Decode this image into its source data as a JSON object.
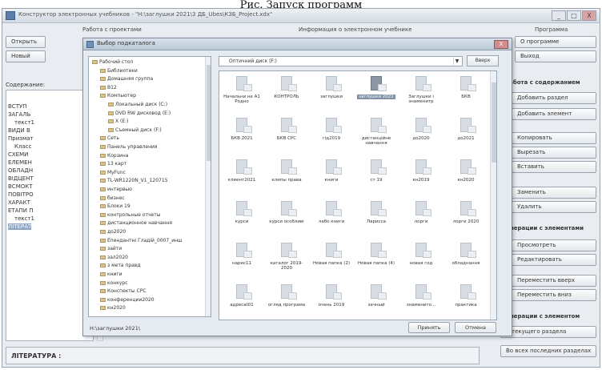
{
  "caption": "Рис. Запуск программ",
  "window": {
    "title": "Конструктор электронных учебников - \"Н:\\заглушки 2021\\3 ДБ_Ubes\\КЗБ_Project.xdx\"",
    "buttons": [
      "_",
      "□",
      "X"
    ]
  },
  "groups": {
    "projects": "Работа с проектами",
    "info": "Информация о электронном учебнике",
    "program": "Программа"
  },
  "toolbar": {
    "open": "Открыть",
    "new": "Новый",
    "about": "О программе",
    "exit": "Выход"
  },
  "content_label": "Содержание:",
  "tree": [
    {
      "label": "ВСТУП"
    },
    {
      "label": "ЗАГАЛЬ"
    },
    {
      "label": "текст1"
    },
    {
      "label": "ВИДИ  В"
    },
    {
      "label": "Призмат"
    },
    {
      "label": "Класс"
    },
    {
      "label": "СХЕМИ"
    },
    {
      "label": "ЕЛЕМЕН"
    },
    {
      "label": "ОБЛАДН"
    },
    {
      "label": "ВІДЦЕНТ"
    },
    {
      "label": "ВСМОКТ"
    },
    {
      "label": "ПОВІТРО"
    },
    {
      "label": "ХАРАКТ"
    },
    {
      "label": "ЕТАПИ П"
    },
    {
      "label": "текст1"
    },
    {
      "label": "ЛІТЕРАТ"
    }
  ],
  "right_panel": {
    "sec_content": "Работа с содержанием",
    "add_section": "Добавить раздел",
    "add_subsection": "Добавить элемент",
    "copy": "Копировать",
    "cut": "Вырезать",
    "paste": "Вставить",
    "rename": "Заменить",
    "delete": "Удалить",
    "sec_elements": "Операции с элементами",
    "view": "Просмотреть",
    "edit": "Редактировать",
    "move_up": "Переместить вверх",
    "move_down": "Переместить вниз",
    "sec_links": "Операции с элементом",
    "to_section": "В текущего раздела",
    "to_all": "Во всех последних разделах"
  },
  "literature": "ЛІТЕРАТУРА :",
  "dialog": {
    "title": "Выбор подкаталога",
    "close": "X",
    "drive": "Оптичний диск (F:)",
    "up": "Вверх",
    "path": "H:\\заглушки 2021\\",
    "ok": "Принять",
    "cancel": "Отмена",
    "folders": [
      {
        "label": "Рабочий стол",
        "indent": 0
      },
      {
        "label": "Библиотеки",
        "indent": 1
      },
      {
        "label": "Домашняя группа",
        "indent": 1
      },
      {
        "label": "В12",
        "indent": 1
      },
      {
        "label": "Компьютер",
        "indent": 1
      },
      {
        "label": "Локальный диск (C:)",
        "indent": 2
      },
      {
        "label": "DVD RW дисковод (E:)",
        "indent": 2
      },
      {
        "label": "Х (E:)",
        "indent": 2
      },
      {
        "label": "Съемный диск (F:)",
        "indent": 2
      },
      {
        "label": "Сеть",
        "indent": 1
      },
      {
        "label": "Панель управления",
        "indent": 1
      },
      {
        "label": "Корзина",
        "indent": 1
      },
      {
        "label": "13 карт",
        "indent": 1
      },
      {
        "label": "MyFunc",
        "indent": 1
      },
      {
        "label": "TL-WR1220N_V1_120715",
        "indent": 1
      },
      {
        "label": "интервью",
        "indent": 1
      },
      {
        "label": "бизнес",
        "indent": 1
      },
      {
        "label": "Блоки 19",
        "indent": 1
      },
      {
        "label": "контрольные отчеты",
        "indent": 1
      },
      {
        "label": "дистанционное навчання",
        "indent": 1
      },
      {
        "label": "до2020",
        "indent": 1
      },
      {
        "label": "Епендантні Гладій_0007_инш",
        "indent": 1
      },
      {
        "label": "зайти",
        "indent": 1
      },
      {
        "label": "зал2020",
        "indent": 1
      },
      {
        "label": "з мета правд",
        "indent": 1
      },
      {
        "label": "книги",
        "indent": 1
      },
      {
        "label": "конкурс",
        "indent": 1
      },
      {
        "label": "Конспекты СРС",
        "indent": 1
      },
      {
        "label": "конференции2020",
        "indent": 1
      },
      {
        "label": "кн2020",
        "indent": 1
      }
    ],
    "files": [
      {
        "label": "Начальни не А1 Родно",
        "selected": false
      },
      {
        "label": "КОНТРОЛЬ",
        "selected": false
      },
      {
        "label": "заглушки",
        "selected": false
      },
      {
        "label": "заглушки 2021",
        "selected": true
      },
      {
        "label": "Заглушки і знаменитр",
        "selected": false
      },
      {
        "label": "БКВ",
        "selected": false
      },
      {
        "label": "БКВ 2021",
        "selected": false
      },
      {
        "label": "БКВ СРС",
        "selected": false
      },
      {
        "label": "гід2019",
        "selected": false
      },
      {
        "label": "дистанційне навчання",
        "selected": false
      },
      {
        "label": "до2020",
        "selected": false
      },
      {
        "label": "до2021",
        "selected": false
      },
      {
        "label": "клиент2021",
        "selected": false
      },
      {
        "label": "клипы права",
        "selected": false
      },
      {
        "label": "книги",
        "selected": false
      },
      {
        "label": "ст 19",
        "selected": false
      },
      {
        "label": "кн2019",
        "selected": false
      },
      {
        "label": "кн2020",
        "selected": false
      },
      {
        "label": "курси",
        "selected": false
      },
      {
        "label": "курси особливі",
        "selected": false
      },
      {
        "label": "лабо книги",
        "selected": false
      },
      {
        "label": "Ларисса",
        "selected": false
      },
      {
        "label": "лорги",
        "selected": false
      },
      {
        "label": "лорги 2020",
        "selected": false
      },
      {
        "label": "нарис11",
        "selected": false
      },
      {
        "label": "каталог 2019-2020",
        "selected": false
      },
      {
        "label": "Новая папка (2)",
        "selected": false
      },
      {
        "label": "Новая папка (4)",
        "selected": false
      },
      {
        "label": "новая год",
        "selected": false
      },
      {
        "label": "обладнання",
        "selected": false
      },
      {
        "label": "адресаt01",
        "selected": false
      },
      {
        "label": "огляд програма",
        "selected": false
      },
      {
        "label": "очень 2019",
        "selected": false
      },
      {
        "label": "зачный",
        "selected": false
      },
      {
        "label": "знаменито...",
        "selected": false
      },
      {
        "label": "практика",
        "selected": false
      }
    ]
  },
  "colors": {
    "window_bg": "#e9edf2",
    "dialog_bg": "#e6ebf1",
    "selection": "#8aa6c4"
  }
}
